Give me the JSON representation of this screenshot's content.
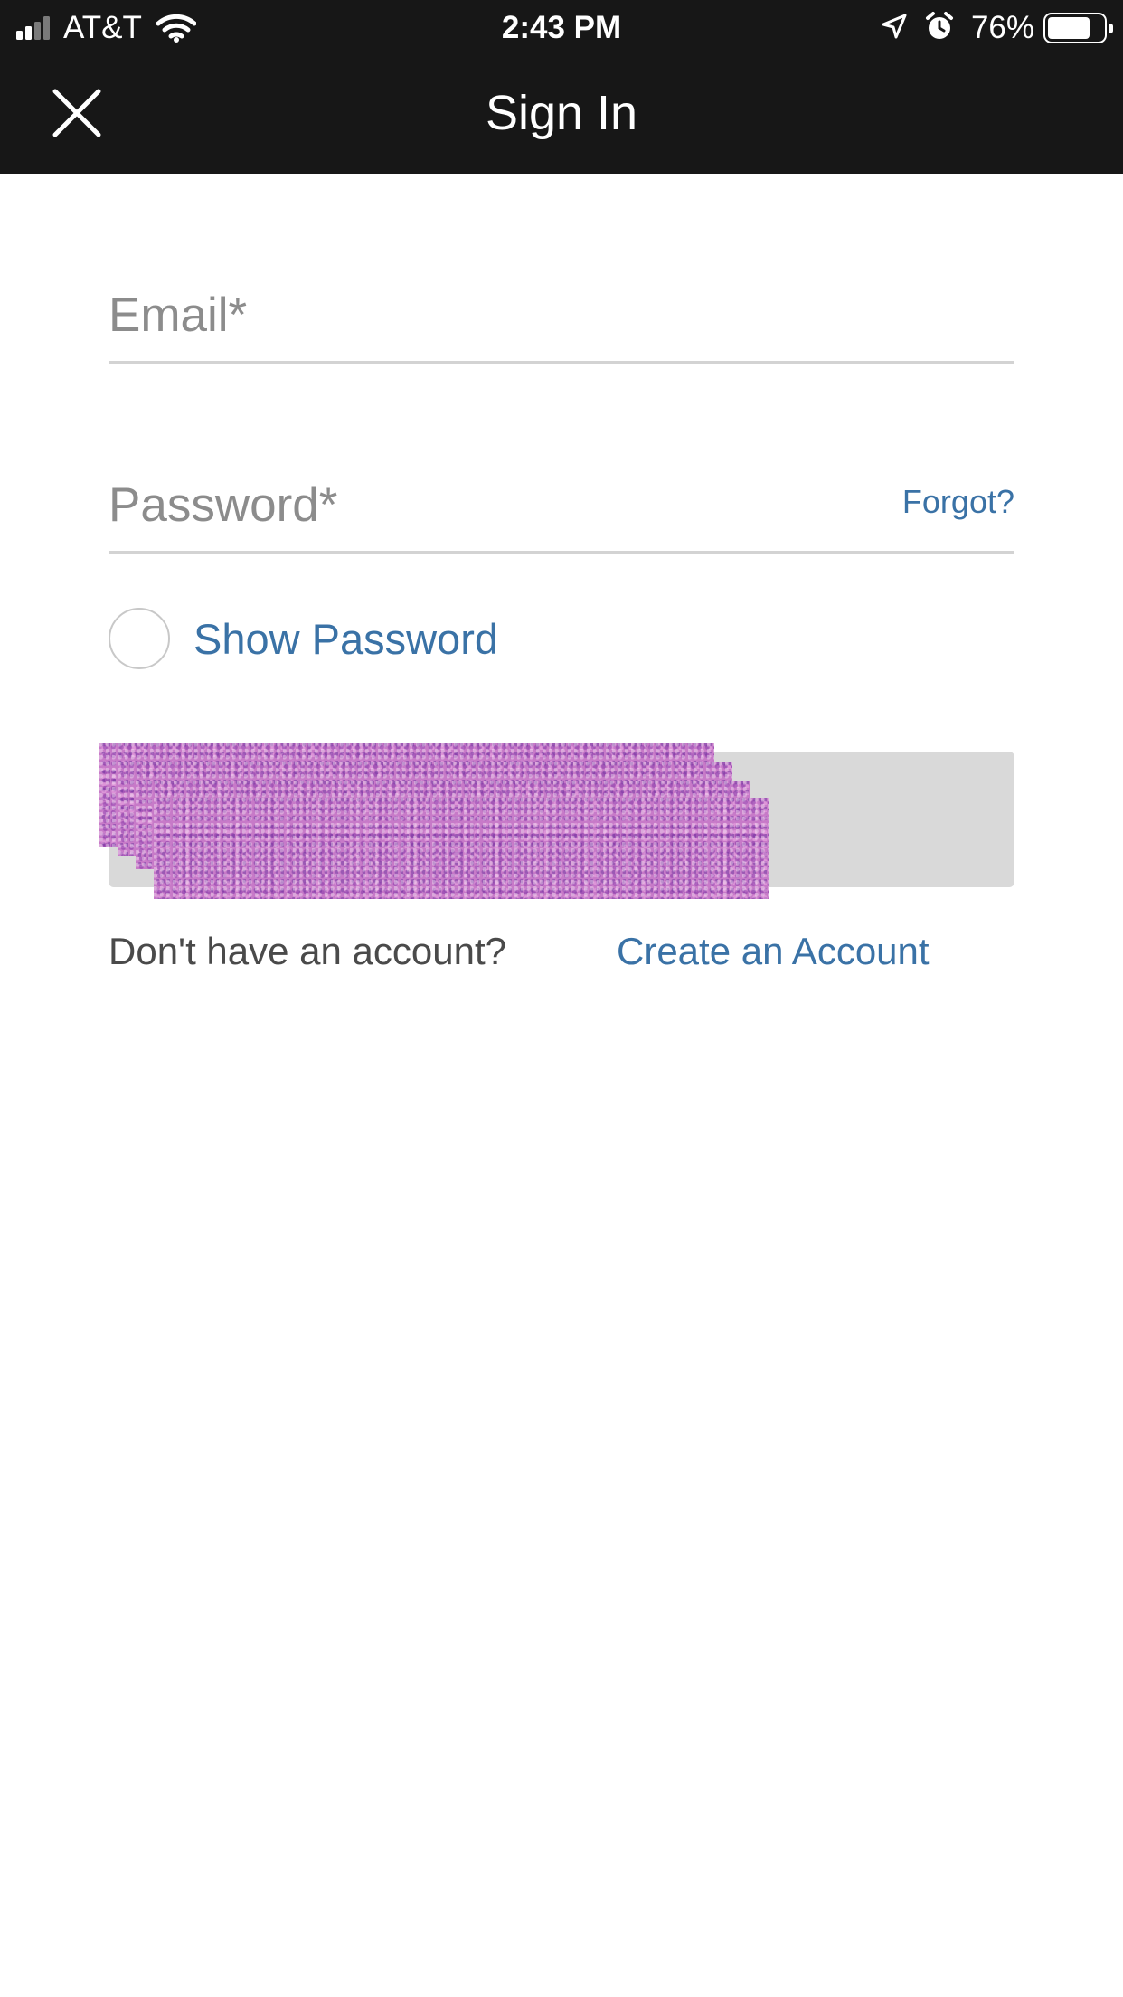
{
  "status_bar": {
    "carrier": "AT&T",
    "time": "2:43 PM",
    "battery_percent": "76%",
    "battery_level": 0.76,
    "signal_bars_filled": 2,
    "icons": [
      "signal-bars-icon",
      "wifi-icon",
      "location-arrow-icon",
      "alarm-clock-icon",
      "battery-icon"
    ]
  },
  "nav": {
    "title": "Sign In",
    "close_icon": "close-icon"
  },
  "form": {
    "email_placeholder": "Email*",
    "email_value": "",
    "password_placeholder": "Password*",
    "password_value": "",
    "forgot_label": "Forgot?",
    "show_password_label": "Show Password",
    "show_password_checked": false,
    "submit_label": ""
  },
  "signup": {
    "prompt": "Don't have an account?",
    "link_label": "Create an Account"
  },
  "colors": {
    "topbar_bg": "#171717",
    "link": "#3a72a6",
    "button_bg": "#d9d9d9",
    "divider": "#d3d3d3"
  }
}
